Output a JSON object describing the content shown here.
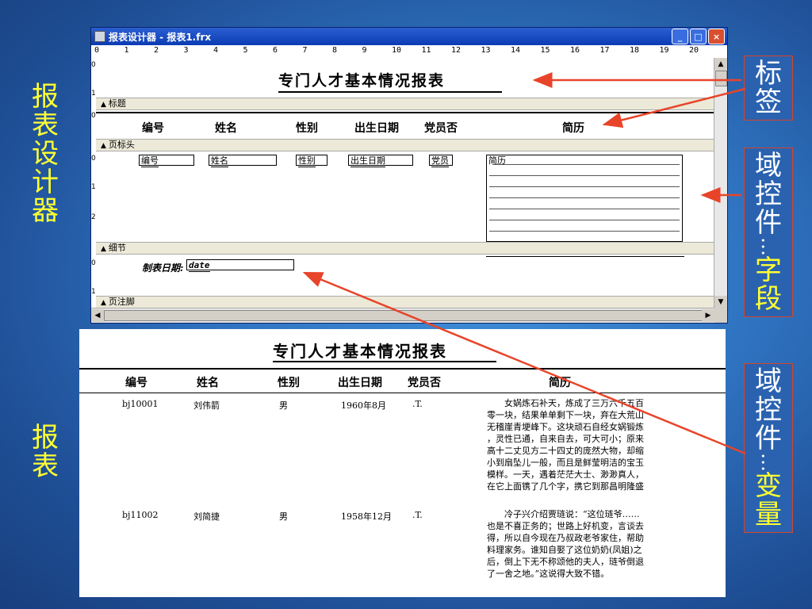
{
  "side_labels": {
    "designer": "报表设计器",
    "report": "报表"
  },
  "callouts": {
    "label": "标签",
    "field_prefix": "域控件",
    "field_dots": "…",
    "field_suffix": "字段",
    "var_prefix": "域控件",
    "var_dots": "…",
    "var_suffix": "变量"
  },
  "window": {
    "title": "报表设计器 - 报表1.frx",
    "buttons": [
      "_",
      "□",
      "×"
    ],
    "ruler_ticks": [
      "0",
      "1",
      "2",
      "3",
      "4",
      "5",
      "6",
      "7",
      "8",
      "9",
      "10",
      "11",
      "12",
      "13",
      "14",
      "15",
      "16",
      "17",
      "18",
      "19",
      "20"
    ],
    "vruler_ticks": [
      "0",
      "1",
      "0",
      "0",
      "1",
      "2",
      "0",
      "1"
    ]
  },
  "designer": {
    "title": "专门人才基本情况报表",
    "band_title": "标题",
    "band_page_header": "页标头",
    "band_detail": "细节",
    "band_page_footer": "页注脚",
    "headers": [
      "编号",
      "姓名",
      "性别",
      "出生日期",
      "党员否",
      "简历"
    ],
    "fields": [
      "编号",
      "姓名",
      "性别",
      "出生日期",
      "党员",
      "简历"
    ],
    "footer_label": "制表日期:",
    "footer_var": "date"
  },
  "report": {
    "title": "专门人才基本情况报表",
    "headers": [
      "编号",
      "姓名",
      "性别",
      "出生日期",
      "党员否",
      "简历"
    ],
    "rows": [
      {
        "id": "bj10001",
        "name": "刘伟箭",
        "gender": "男",
        "birth": "1960年8月",
        "party": ".T.",
        "bio": [
          "女娲炼石补天，炼成了三万六千五百",
          "零一块，结果单单剩下一块，弃在大荒山",
          "无稽崖青埂峰下。这块顽石自经女娲锻炼",
          "，灵性已通，自来自去，可大可小；原来",
          "高十二丈见方二十四丈的庞然大物，却缩",
          "小到扇坠儿一般，而且是鲜莹明洁的宝玉",
          "模样。一天，遇着茫茫大士、渺渺真人，",
          "在它上面镌了几个字，携它到那昌明隆盛"
        ]
      },
      {
        "id": "bj11002",
        "name": "刘简捷",
        "gender": "男",
        "birth": "1958年12月",
        "party": ".T.",
        "bio": [
          "冷子兴介绍贾琏说：“这位琏爷……",
          "也是不喜正务的；世路上好机变，言谈去",
          "得，所以自今现在乃叔政老爷家住，帮助",
          "料理家务。谁知自娶了这位奶奶(凤姐)之",
          "后，倒上下无不称颂他的夫人，琏爷倒退",
          "了一舍之地。”这说得大致不错。"
        ]
      }
    ]
  }
}
